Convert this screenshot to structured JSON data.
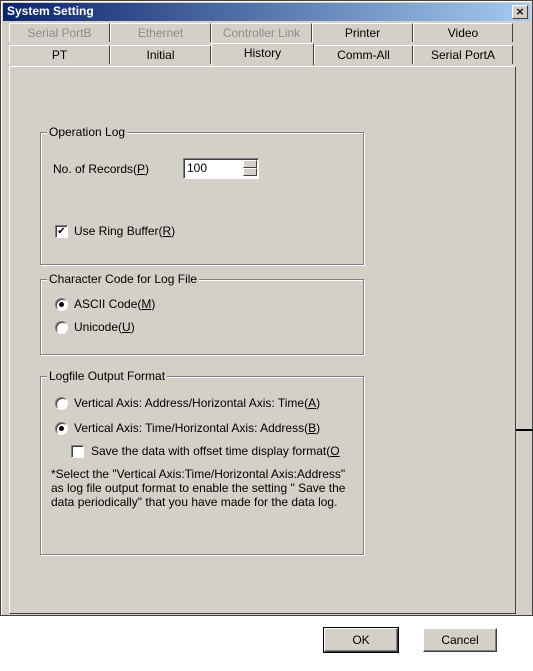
{
  "window": {
    "title": "System Setting",
    "close_glyph": "×"
  },
  "tabs_back": [
    "Serial PortB",
    "Ethernet",
    "Controller Link",
    "Printer",
    "Video"
  ],
  "tabs_front": [
    "PT",
    "Initial",
    "History",
    "Comm-All",
    "Serial PortA"
  ],
  "selected_tab": "History",
  "operation_log": {
    "legend": "Operation Log",
    "records_label_pre": "No. of Records(",
    "records_label_key": "P",
    "records_label_post": ")",
    "records_value": "100",
    "ring_pre": "Use Ring Buffer(",
    "ring_key": "R",
    "ring_post": ")",
    "ring_checked": true
  },
  "char_code": {
    "legend": "Character Code for Log File",
    "ascii_pre": "ASCII Code(",
    "ascii_key": "M",
    "ascii_post": ")",
    "unicode_pre": "Unicode(",
    "unicode_key": "U",
    "unicode_post": ")",
    "selected": "ascii"
  },
  "logfile_format": {
    "legend": "Logfile Output Format",
    "opt_a_pre": "Vertical Axis: Address/Horizontal Axis: Time(",
    "opt_a_key": "A",
    "opt_a_post": ")",
    "opt_b_pre": "Vertical Axis: Time/Horizontal Axis: Address(",
    "opt_b_key": "B",
    "opt_b_post": ")",
    "selected": "b",
    "offset_pre": "Save the data with offset time display format(",
    "offset_key": "O",
    "offset_checked": false,
    "note": "*Select the \"Vertical Axis:Time/Horizontal Axis:Address\" as log file output format to enable the setting \" Save the data periodically\" that you have made for the data log."
  },
  "buttons": {
    "ok": "OK",
    "cancel": "Cancel"
  },
  "check_glyph": "✔"
}
